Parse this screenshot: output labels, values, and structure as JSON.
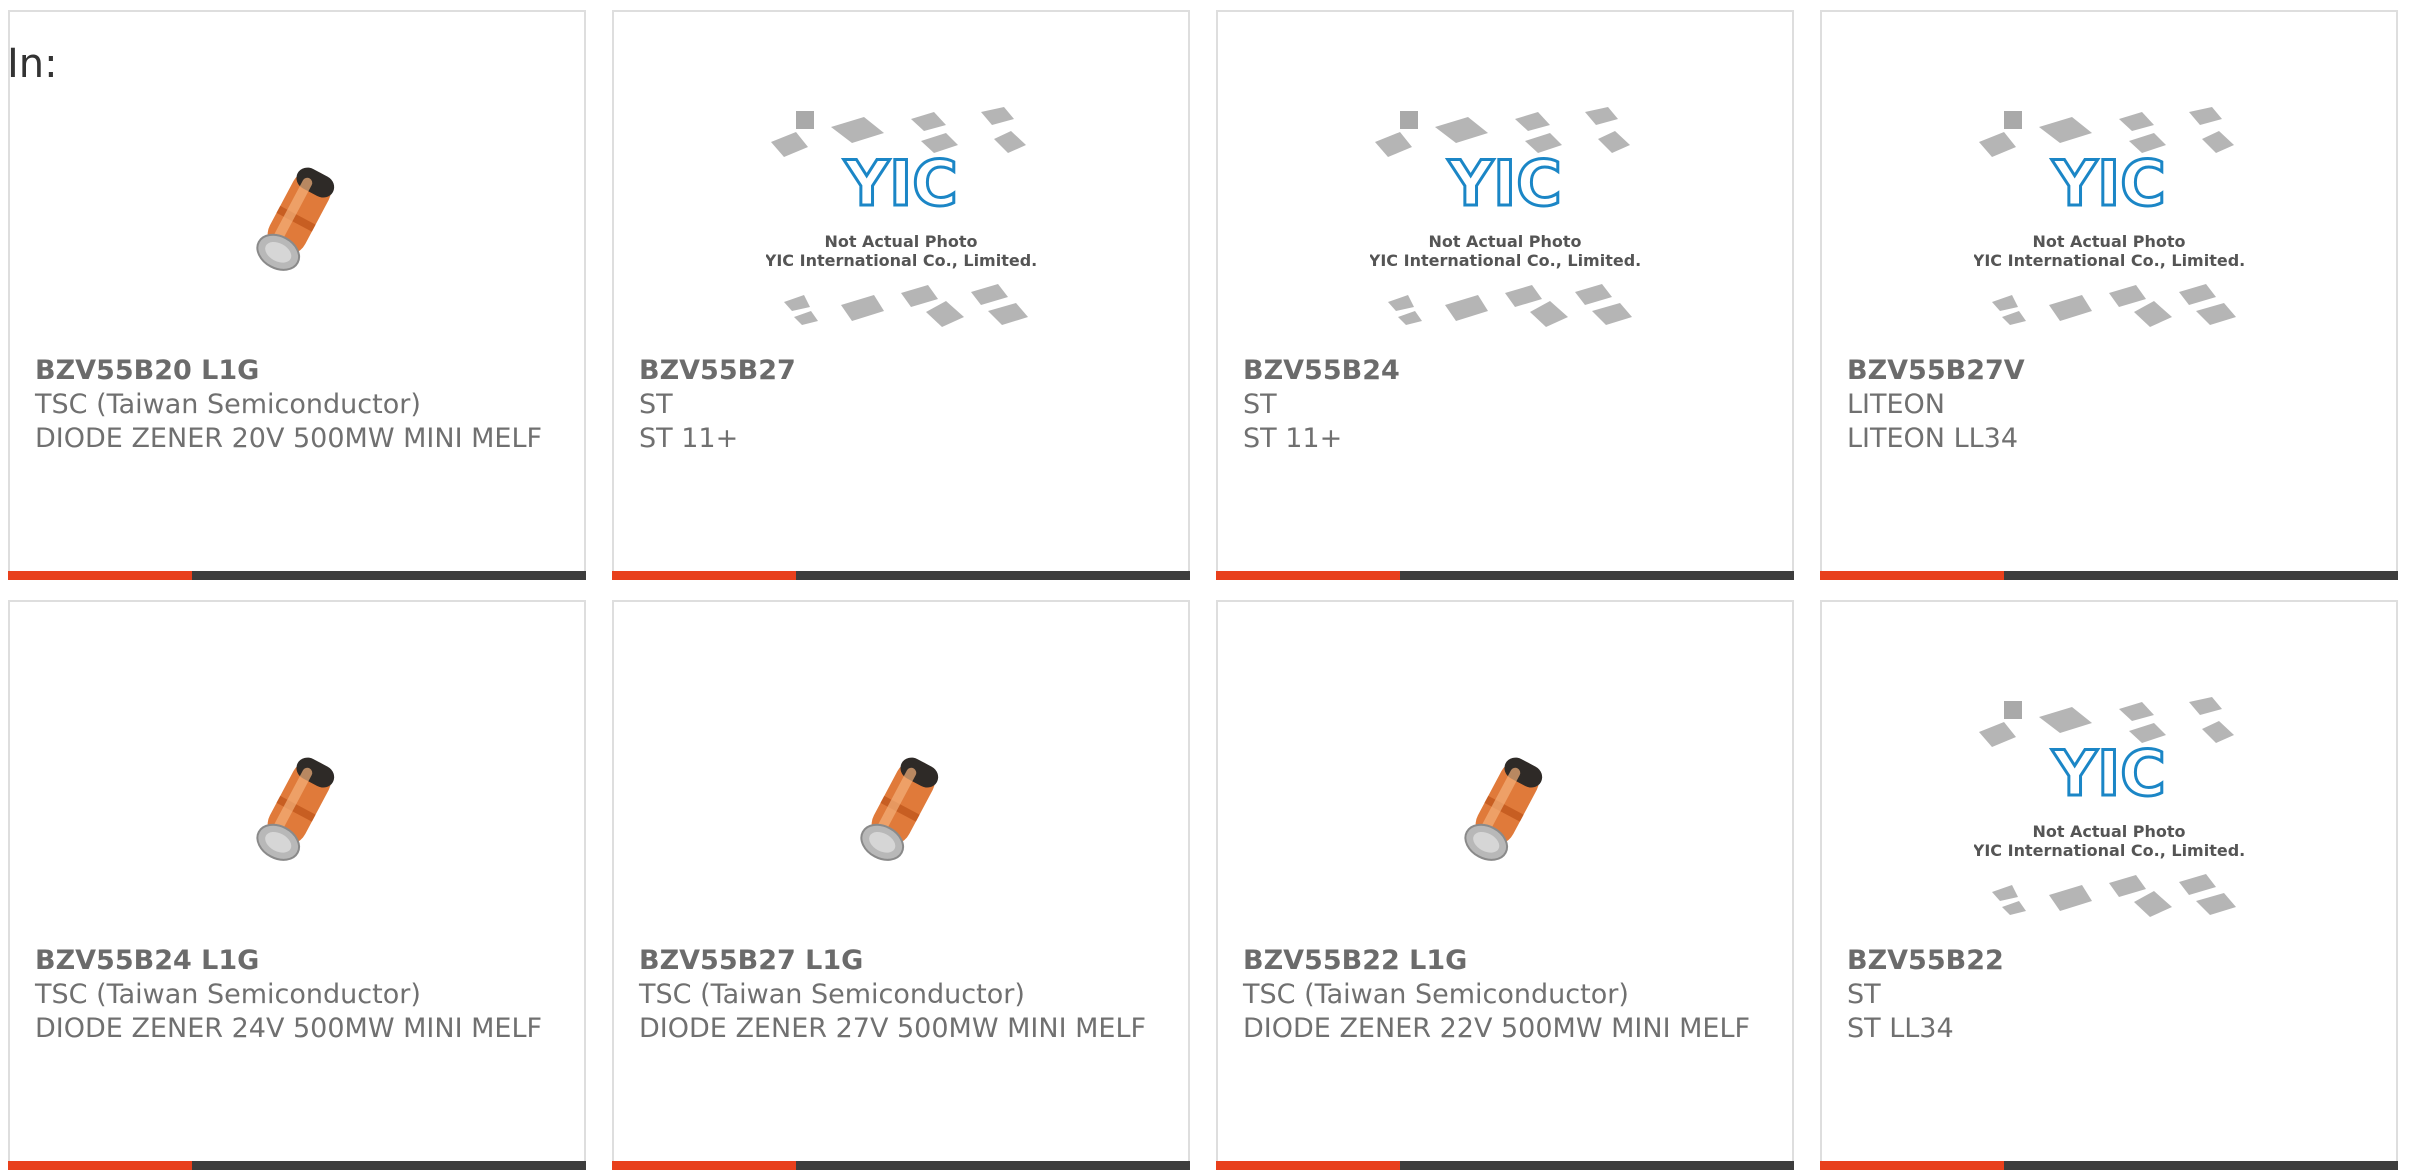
{
  "header": {
    "in_label": "In:"
  },
  "colors": {
    "accent": "#e8401c",
    "bar": "#3d3d3d",
    "text": "#707070",
    "logo_blue": "#1b86c6"
  },
  "placeholder": {
    "line1": "Not Actual Photo",
    "line2": "YIC International Co., Limited.",
    "logo_text": "YIC"
  },
  "products": [
    {
      "part": "BZV55B20 L1G",
      "maker": "TSC (Taiwan Semiconductor)",
      "desc": "DIODE ZENER 20V 500MW MINI MELF",
      "image": "diode-photo"
    },
    {
      "part": "BZV55B27",
      "maker": "ST",
      "desc": "ST 11+",
      "image": "not-actual-photo"
    },
    {
      "part": "BZV55B24",
      "maker": "ST",
      "desc": "ST 11+",
      "image": "not-actual-photo"
    },
    {
      "part": "BZV55B27V",
      "maker": "LITEON",
      "desc": "LITEON LL34",
      "image": "not-actual-photo"
    },
    {
      "part": "BZV55B24 L1G",
      "maker": "TSC (Taiwan Semiconductor)",
      "desc": "DIODE ZENER 24V 500MW MINI MELF",
      "image": "diode-photo"
    },
    {
      "part": "BZV55B27 L1G",
      "maker": "TSC (Taiwan Semiconductor)",
      "desc": "DIODE ZENER 27V 500MW MINI MELF",
      "image": "diode-photo"
    },
    {
      "part": "BZV55B22 L1G",
      "maker": "TSC (Taiwan Semiconductor)",
      "desc": "DIODE ZENER 22V 500MW MINI MELF",
      "image": "diode-photo"
    },
    {
      "part": "BZV55B22",
      "maker": "ST",
      "desc": "ST LL34",
      "image": "not-actual-photo"
    }
  ]
}
